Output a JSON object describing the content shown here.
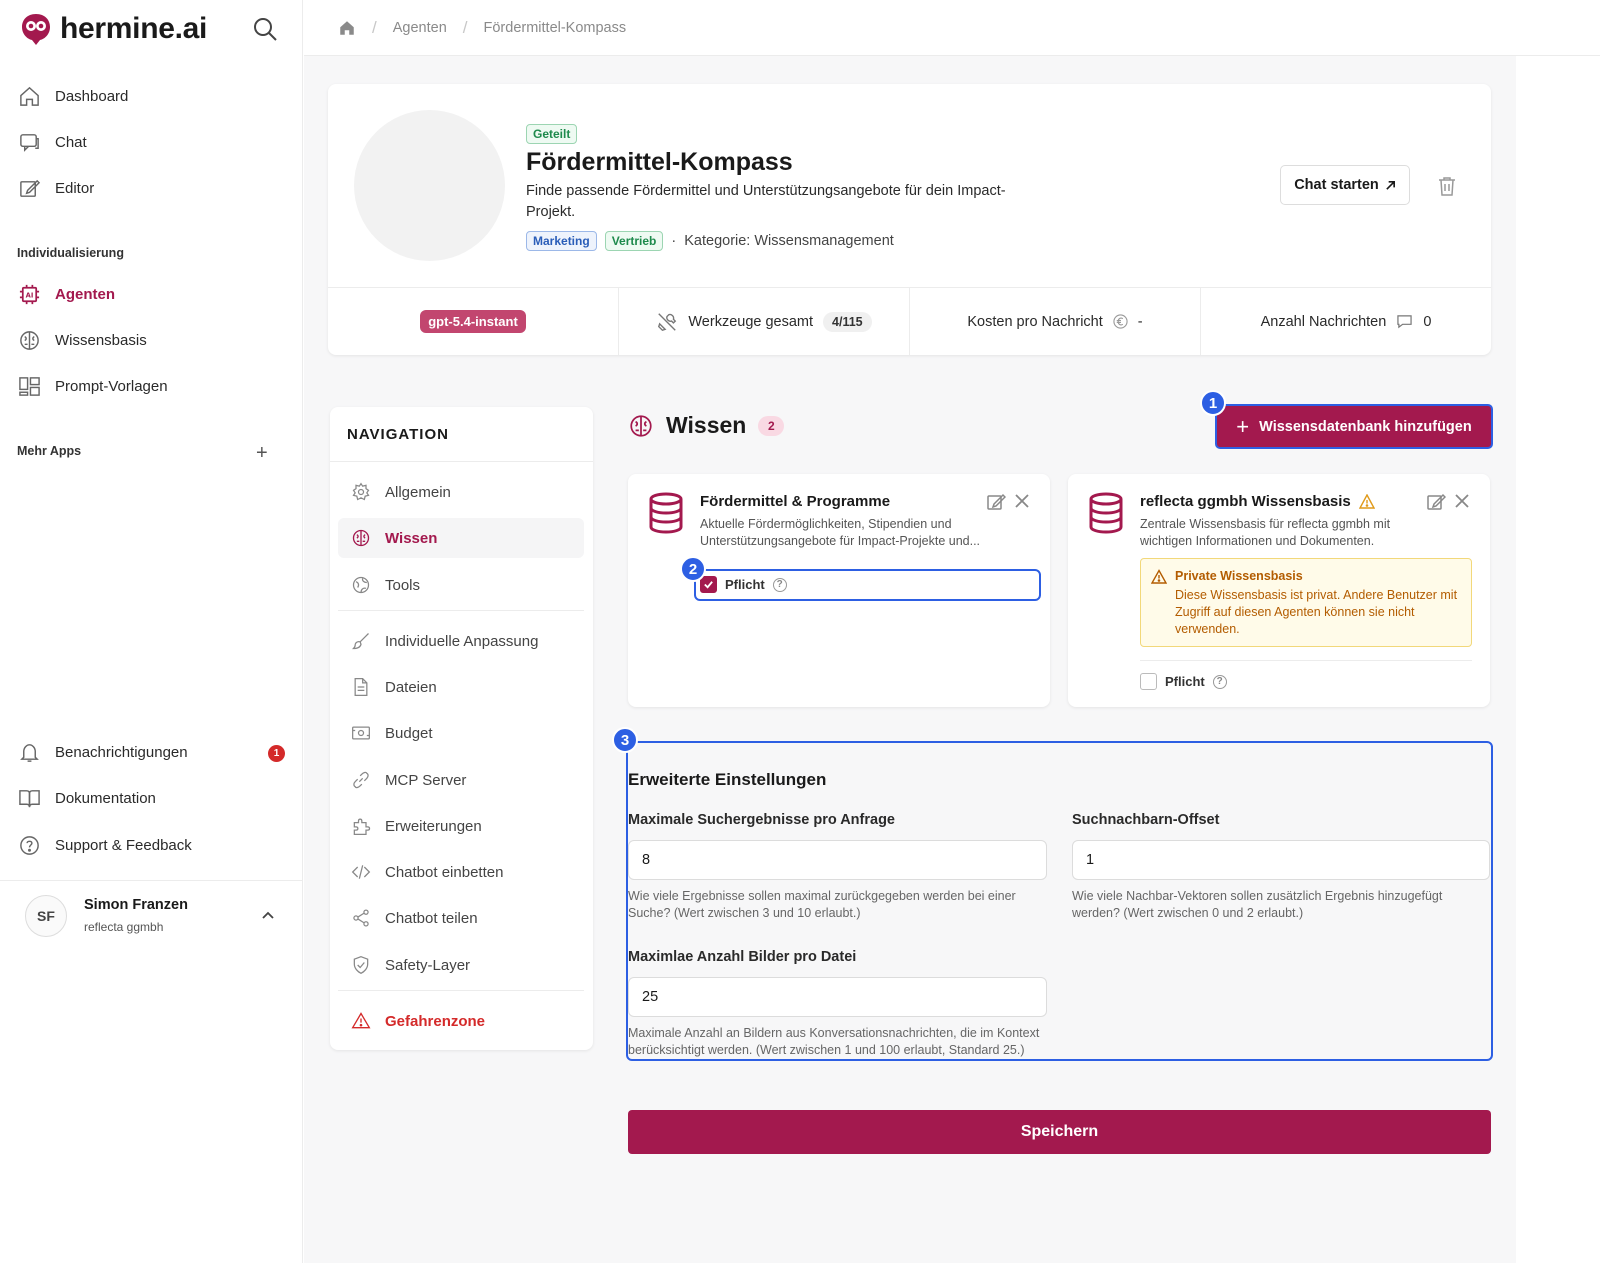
{
  "app": {
    "name": "hermine.ai"
  },
  "sidebar": {
    "items_top": [
      {
        "label": "Dashboard",
        "icon": "home-icon"
      },
      {
        "label": "Chat",
        "icon": "chat-icon"
      },
      {
        "label": "Editor",
        "icon": "edit-icon"
      }
    ],
    "section_individualisierung": "Individualisierung",
    "items_custom": [
      {
        "label": "Agenten",
        "icon": "agent-icon",
        "active": true
      },
      {
        "label": "Wissensbasis",
        "icon": "brain-icon"
      },
      {
        "label": "Prompt-Vorlagen",
        "icon": "template-icon"
      }
    ],
    "section_more_apps": "Mehr Apps",
    "items_bottom": [
      {
        "label": "Benachrichtigungen",
        "icon": "bell-icon",
        "badge": "1"
      },
      {
        "label": "Dokumentation",
        "icon": "book-icon"
      },
      {
        "label": "Support & Feedback",
        "icon": "help-icon"
      }
    ],
    "user": {
      "initials": "SF",
      "name": "Simon Franzen",
      "org": "reflecta ggmbh"
    }
  },
  "breadcrumb": {
    "level1": "Agenten",
    "level2": "Fördermittel-Kompass"
  },
  "agent": {
    "shared_tag": "Geteilt",
    "title": "Fördermittel-Kompass",
    "description": "Finde passende Fördermittel und Unterstützungsangebote für dein Impact-Projekt.",
    "tags": [
      "Marketing",
      "Vertrieb"
    ],
    "category": "Kategorie: Wissensmanagement",
    "chat_button": "Chat starten",
    "stats": {
      "model": "gpt-5.4-instant",
      "tools_label": "Werkzeuge gesamt",
      "tools_count": "4/115",
      "cost_label": "Kosten pro Nachricht",
      "cost_value": "-",
      "messages_label": "Anzahl Nachrichten",
      "messages_value": "0"
    }
  },
  "navigation": {
    "title": "NAVIGATION",
    "items": [
      {
        "label": "Allgemein"
      },
      {
        "label": "Wissen"
      },
      {
        "label": "Tools"
      },
      {
        "label": "Individuelle Anpassung"
      },
      {
        "label": "Dateien"
      },
      {
        "label": "Budget"
      },
      {
        "label": "MCP Server"
      },
      {
        "label": "Erweiterungen"
      },
      {
        "label": "Chatbot einbetten"
      },
      {
        "label": "Chatbot teilen"
      },
      {
        "label": "Safety-Layer"
      },
      {
        "label": "Gefahrenzone"
      }
    ]
  },
  "wissen": {
    "title": "Wissen",
    "count": "2",
    "add_button": "Wissensdatenbank hinzufügen",
    "knowledge_bases": [
      {
        "name": "Fördermittel & Programme",
        "description": "Aktuelle Fördermöglichkeiten, Stipendien und Unterstützungsangebote für Impact-Projekte und...",
        "required_label": "Pflicht",
        "required": true
      },
      {
        "name": "reflecta ggmbh Wissensbasis",
        "description": "Zentrale Wissensbasis für reflecta ggmbh mit wichtigen Informationen und Dokumenten.",
        "warning_title": "Private Wissensbasis",
        "warning_text": "Diese Wissensbasis ist privat. Andere Benutzer mit Zugriff auf diesen Agenten können sie nicht verwenden.",
        "required_label": "Pflicht",
        "required": false
      }
    ]
  },
  "advanced": {
    "title": "Erweiterte Einstellungen",
    "max_results": {
      "label": "Maximale Suchergebnisse pro Anfrage",
      "value": "8",
      "help": "Wie viele Ergebnisse sollen maximal zurückgegeben werden bei einer Suche? (Wert zwischen 3 und 10 erlaubt.)"
    },
    "neighbor_offset": {
      "label": "Suchnachbarn-Offset",
      "value": "1",
      "help": "Wie viele Nachbar-Vektoren sollen zusätzlich Ergebnis hinzugefügt werden? (Wert zwischen 0 und 2 erlaubt.)"
    },
    "max_images": {
      "label": "Maximlae Anzahl Bilder pro Datei",
      "value": "25",
      "help": "Maximale Anzahl an Bildern aus Konversationsnachrichten, die im Kontext berücksichtigt werden. (Wert zwischen 1 und 100 erlaubt, Standard 25.)"
    }
  },
  "save_button": "Speichern",
  "markers": [
    "1",
    "2",
    "3"
  ],
  "colors": {
    "accent": "#a3194e",
    "highlight": "#2d5fe3"
  }
}
